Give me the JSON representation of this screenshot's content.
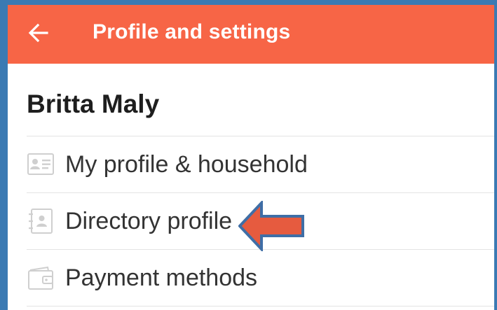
{
  "colors": {
    "appbar": "#f76546",
    "frame": "#3b7ab3",
    "arrow_fill": "#e65b3f",
    "arrow_outline": "#3f6ea6"
  },
  "header": {
    "title": "Profile and settings",
    "back_icon": "arrow-left-icon"
  },
  "profile": {
    "name": "Britta Maly"
  },
  "menu": {
    "items": [
      {
        "label": "My profile & household",
        "icon": "id-card-icon"
      },
      {
        "label": "Directory profile",
        "icon": "address-book-icon"
      },
      {
        "label": "Payment methods",
        "icon": "wallet-icon"
      }
    ]
  },
  "annotation": {
    "icon": "pointer-arrow",
    "points_to": "Directory profile"
  }
}
